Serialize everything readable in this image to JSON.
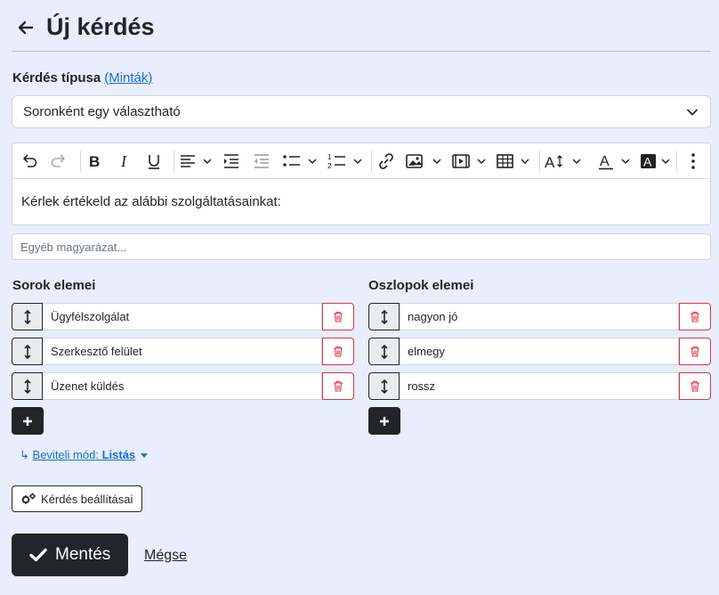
{
  "header": {
    "title": "Új kérdés",
    "back_icon": "arrow-left-icon"
  },
  "question_type": {
    "label": "Kérdés típusa",
    "samples_link": "(Minták)",
    "selected": "Soronként egy választható"
  },
  "editor": {
    "toolbar_icons": [
      "undo-icon",
      "redo-icon",
      "bold-icon",
      "italic-icon",
      "underline-icon",
      "align-icon",
      "indent-icon",
      "outdent-icon",
      "bulleted-list-icon",
      "numbered-list-icon",
      "link-icon",
      "image-upload-icon",
      "media-icon",
      "table-icon",
      "font-size-icon",
      "font-color-icon",
      "background-color-icon",
      "more-icon"
    ],
    "content": "Kérlek értékeld az alábbi szolgáltatásainkat:"
  },
  "explanation": {
    "placeholder": "Egyéb magyarázat..."
  },
  "rows": {
    "title": "Sorok elemei",
    "items": [
      "Ügyfélszolgálat",
      "Szerkesztő felület",
      "Üzenet küldés"
    ]
  },
  "columns": {
    "title": "Oszlopok elemei",
    "items": [
      "nagyon jó",
      "elmegy",
      "rossz"
    ]
  },
  "input_mode": {
    "prefix": "↳",
    "label": "Beviteli mód:",
    "value": "Listás"
  },
  "settings_button": "Kérdés beállításai",
  "save_button": "Mentés",
  "cancel_link": "Mégse",
  "colors": {
    "background": "#e8eefb",
    "dark": "#212529",
    "link": "#1a6fd1",
    "danger": "#dc3545"
  }
}
